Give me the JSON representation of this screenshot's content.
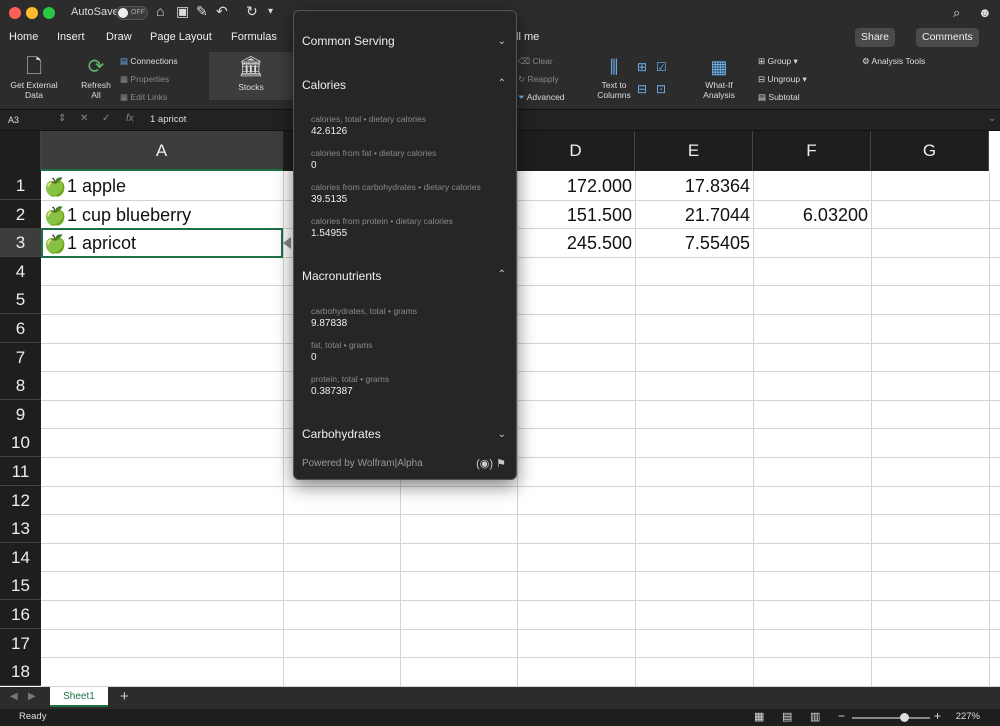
{
  "titlebar": {
    "autosave": "AutoSave",
    "toggle": "OFF"
  },
  "menu": [
    "Home",
    "Insert",
    "Draw",
    "Page Layout",
    "Formulas",
    "ll me"
  ],
  "share": "Share",
  "comments": "Comments",
  "ribbon": {
    "get_external": "Get External\nData",
    "refresh": "Refresh\nAll",
    "connections": "Connections",
    "properties": "Properties",
    "edit_links": "Edit Links",
    "stocks": "Stocks",
    "clear": "Clear",
    "reapply": "Reapply",
    "advanced": "Advanced",
    "text_to_columns": "Text to\nColumns",
    "what_if": "What-If\nAnalysis",
    "group": "Group",
    "ungroup": "Ungroup",
    "subtotal": "Subtotal",
    "analysis_tools": "Analysis Tools"
  },
  "formula": {
    "namebox": "A3",
    "fx": "fx",
    "value": "1 apricot"
  },
  "columns": [
    "A",
    "D",
    "E",
    "F",
    "G"
  ],
  "rows": [
    "1",
    "2",
    "3",
    "4",
    "5",
    "6",
    "7",
    "8",
    "9",
    "10",
    "11",
    "12",
    "13",
    "14",
    "15",
    "16",
    "17",
    "18"
  ],
  "cells": {
    "a1": "1 apple",
    "a2": "1 cup blueberry",
    "a3": "1 apricot",
    "d1": "172.000",
    "e1": "17.8364",
    "d2": "151.500",
    "e2": "21.7044",
    "f2": "6.03200",
    "d3": "245.500",
    "e3": "7.55405"
  },
  "popup": {
    "common_serving": "Common Serving",
    "calories": "Calories",
    "cal_items": [
      {
        "label": "calories, total • dietary calories",
        "value": "42.6126"
      },
      {
        "label": "calories from fat • dietary calories",
        "value": "0"
      },
      {
        "label": "calories from carbohydrates • dietary calories",
        "value": "39.5135"
      },
      {
        "label": "calories from protein • dietary calories",
        "value": "1.54955"
      }
    ],
    "macronutrients": "Macronutrients",
    "macro_items": [
      {
        "label": "carbohydrates, total • grams",
        "value": "9.87838"
      },
      {
        "label": "fat, total • grams",
        "value": "0"
      },
      {
        "label": "protein, total • grams",
        "value": "0.387387"
      }
    ],
    "carbohydrates": "Carbohydrates",
    "powered": "Powered by Wolfram|Alpha"
  },
  "sheet": "Sheet1",
  "status": "Ready",
  "zoom": "227%"
}
